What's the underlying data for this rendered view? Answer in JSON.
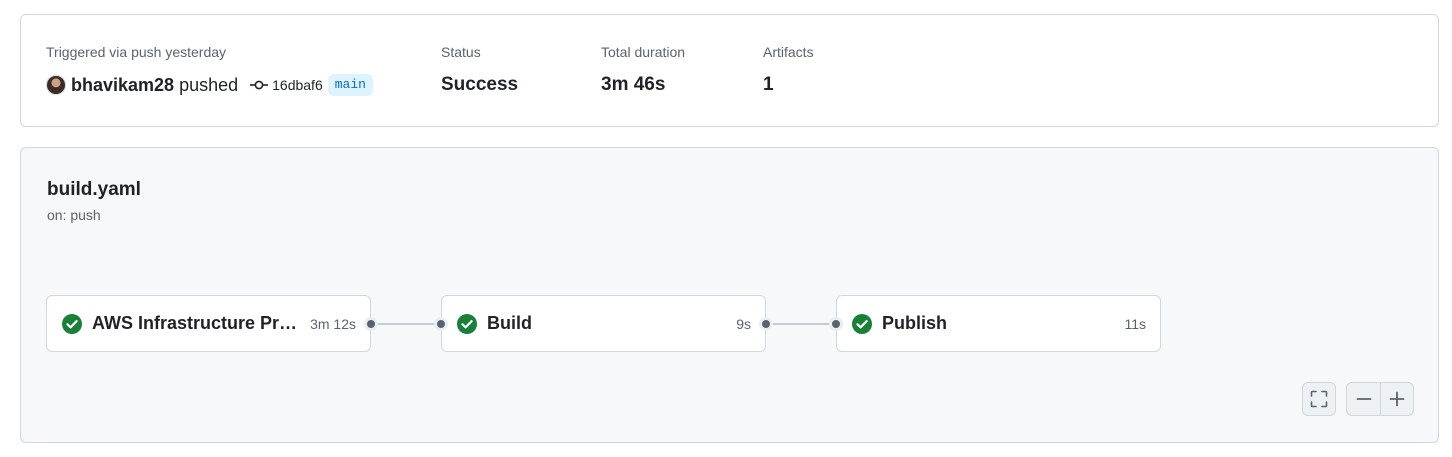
{
  "summary": {
    "trigger_label": "Triggered via push yesterday",
    "actor": "bhavikam28",
    "action": "pushed",
    "commit_sha": "16dbaf6",
    "branch": "main",
    "status_label": "Status",
    "status_value": "Success",
    "duration_label": "Total duration",
    "duration_value": "3m 46s",
    "artifacts_label": "Artifacts",
    "artifacts_value": "1"
  },
  "workflow": {
    "name": "build.yaml",
    "trigger": "on: push",
    "jobs": [
      {
        "name": "AWS Infrastructure Provisioning",
        "duration": "3m 12s",
        "status": "success"
      },
      {
        "name": "Build",
        "duration": "9s",
        "status": "success"
      },
      {
        "name": "Publish",
        "duration": "11s",
        "status": "success"
      }
    ]
  },
  "controls": {
    "fullscreen_icon": "fullscreen-icon",
    "zoom_out_icon": "zoom-out-icon",
    "zoom_in_icon": "zoom-in-icon"
  },
  "colors": {
    "success": "#1a7f37",
    "branch_bg": "#ddf4ff",
    "branch_fg": "#0969da",
    "muted": "#59636e"
  }
}
